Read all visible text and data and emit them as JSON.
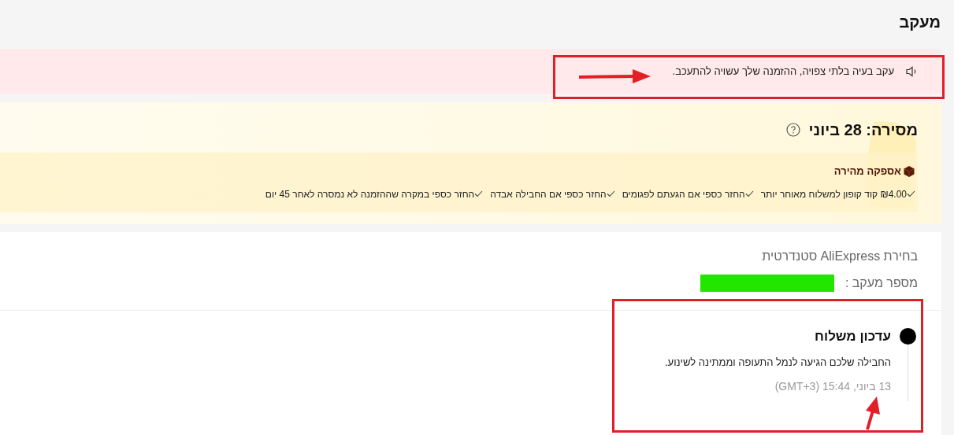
{
  "page": {
    "title": "מעקב"
  },
  "notice": {
    "text": "עקב בעיה בלתי צפויה, ההזמנה שלך עשויה להתעכב."
  },
  "delivery": {
    "heading": "מסירה: 28 ביוני",
    "badge": "אספקה מהירה",
    "guarantees": [
      "₪4.00 קוד קופון למשלוח מאוחר יותר",
      "החזר כספי אם הגעתם לפגומים",
      "החזר כספי אם החבילה אבדה",
      "החזר כספי במקרה שההזמנה לא נמסרה לאחר 45 יום"
    ]
  },
  "shipping": {
    "method": "בחירת AliExpress סטנדרטית",
    "tracking_label": "מספר מעקב :"
  },
  "timeline": [
    {
      "title": "עדכון משלוח",
      "description": "החבילה שלכם הגיעה לנמל התעופה וממתינה לשינוע.",
      "time": "13 ביוני, 15:44 (GMT+3)"
    }
  ]
}
